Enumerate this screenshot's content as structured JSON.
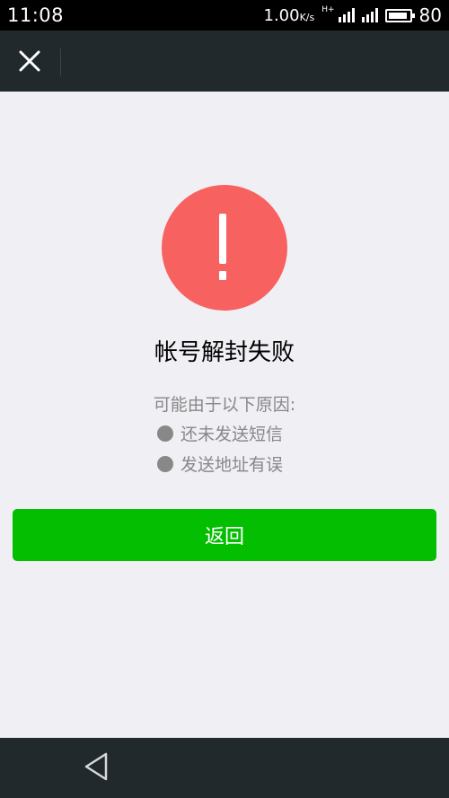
{
  "status_bar": {
    "time": "11:08",
    "speed": "1.00",
    "speed_unit": "K/s",
    "network_type": "H+",
    "battery_level": "80",
    "battery_fraction": 0.8
  },
  "nav": {
    "close_icon": "close-icon"
  },
  "main": {
    "icon": "warning-icon",
    "icon_color": "#f76260",
    "title": "帐号解封失败",
    "reason_label": "可能由于以下原因:",
    "reasons": [
      "还未发送短信",
      "发送地址有误"
    ],
    "button_label": "返回",
    "button_color": "#04be02"
  },
  "system_nav": {
    "back_icon": "back-triangle-icon"
  }
}
